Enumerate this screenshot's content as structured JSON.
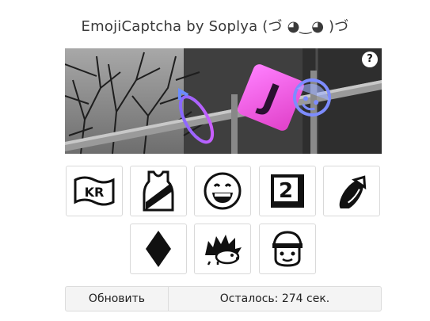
{
  "title": "EmojiCaptcha by Soplya (づ ◕‿◕ )づ",
  "captcha": {
    "help_label": "?",
    "overlay_emojis": [
      "eggplant-icon",
      "j-badge-icon",
      "cap-face-icon"
    ]
  },
  "options": [
    {
      "icon": "flag-kr-icon"
    },
    {
      "icon": "running-shirt-icon"
    },
    {
      "icon": "grinning-face-icon"
    },
    {
      "icon": "keycap-2-icon"
    },
    {
      "icon": "eggplant-icon"
    },
    {
      "icon": "black-diamond-icon"
    },
    {
      "icon": "hedgehog-icon"
    },
    {
      "icon": "cap-face-icon"
    }
  ],
  "footer": {
    "refresh_label": "Обновить",
    "timer_text": "Осталось: 274 сек."
  }
}
